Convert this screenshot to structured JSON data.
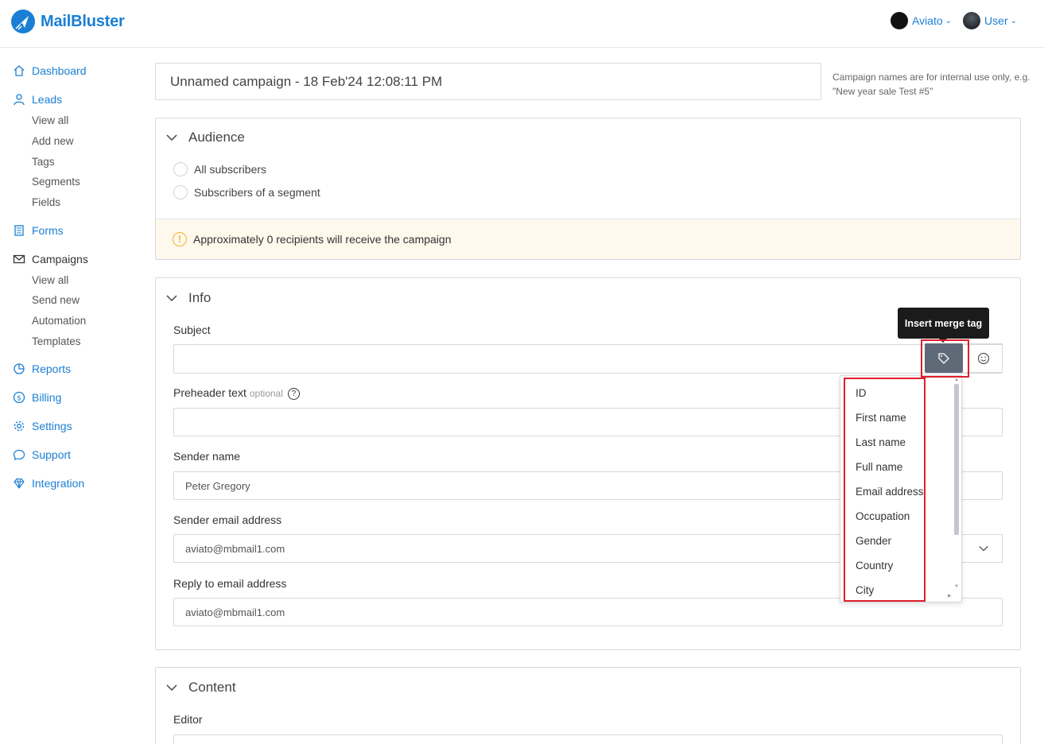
{
  "brand": {
    "name": "MailBluster",
    "color": "#1a7fd4"
  },
  "header": {
    "account": "Aviato",
    "user": "User"
  },
  "sidebar": {
    "dashboard": "Dashboard",
    "leads": "Leads",
    "leads_items": [
      "View all",
      "Add new",
      "Tags",
      "Segments",
      "Fields"
    ],
    "forms": "Forms",
    "campaigns": "Campaigns",
    "campaigns_items": [
      "View all",
      "Send new",
      "Automation",
      "Templates"
    ],
    "reports": "Reports",
    "billing": "Billing",
    "settings": "Settings",
    "support": "Support",
    "integration": "Integration"
  },
  "campaign": {
    "name": "Unnamed campaign - 18 Feb'24 12:08:11 PM",
    "hint": "Campaign names are for internal use only, e.g. \"New year sale Test #5\""
  },
  "audience": {
    "title": "Audience",
    "options": [
      "All subscribers",
      "Subscribers of a segment"
    ],
    "notice": "Approximately 0 recipients will receive the campaign",
    "notice_icon": "!"
  },
  "info": {
    "title": "Info",
    "subject_label": "Subject",
    "subject_value": "",
    "preheader_label": "Preheader text",
    "preheader_optional": "optional",
    "help_icon": "?",
    "preheader_value": "",
    "sender_name_label": "Sender name",
    "sender_name_value": "Peter Gregory",
    "sender_email_label": "Sender email address",
    "sender_email_value": "aviato@mbmail1.com",
    "reply_to_label": "Reply to email address",
    "reply_to_value": "aviato@mbmail1.com"
  },
  "merge_tag": {
    "tooltip": "Insert merge tag",
    "items": [
      "ID",
      "First name",
      "Last name",
      "Full name",
      "Email address",
      "Occupation",
      "Gender",
      "Country",
      "City"
    ]
  },
  "content": {
    "title": "Content",
    "editor_label": "Editor"
  },
  "colors": {
    "highlight": "#e01e2b",
    "tag_button": "#5f6a78",
    "notice_bg": "#fff8ec"
  }
}
